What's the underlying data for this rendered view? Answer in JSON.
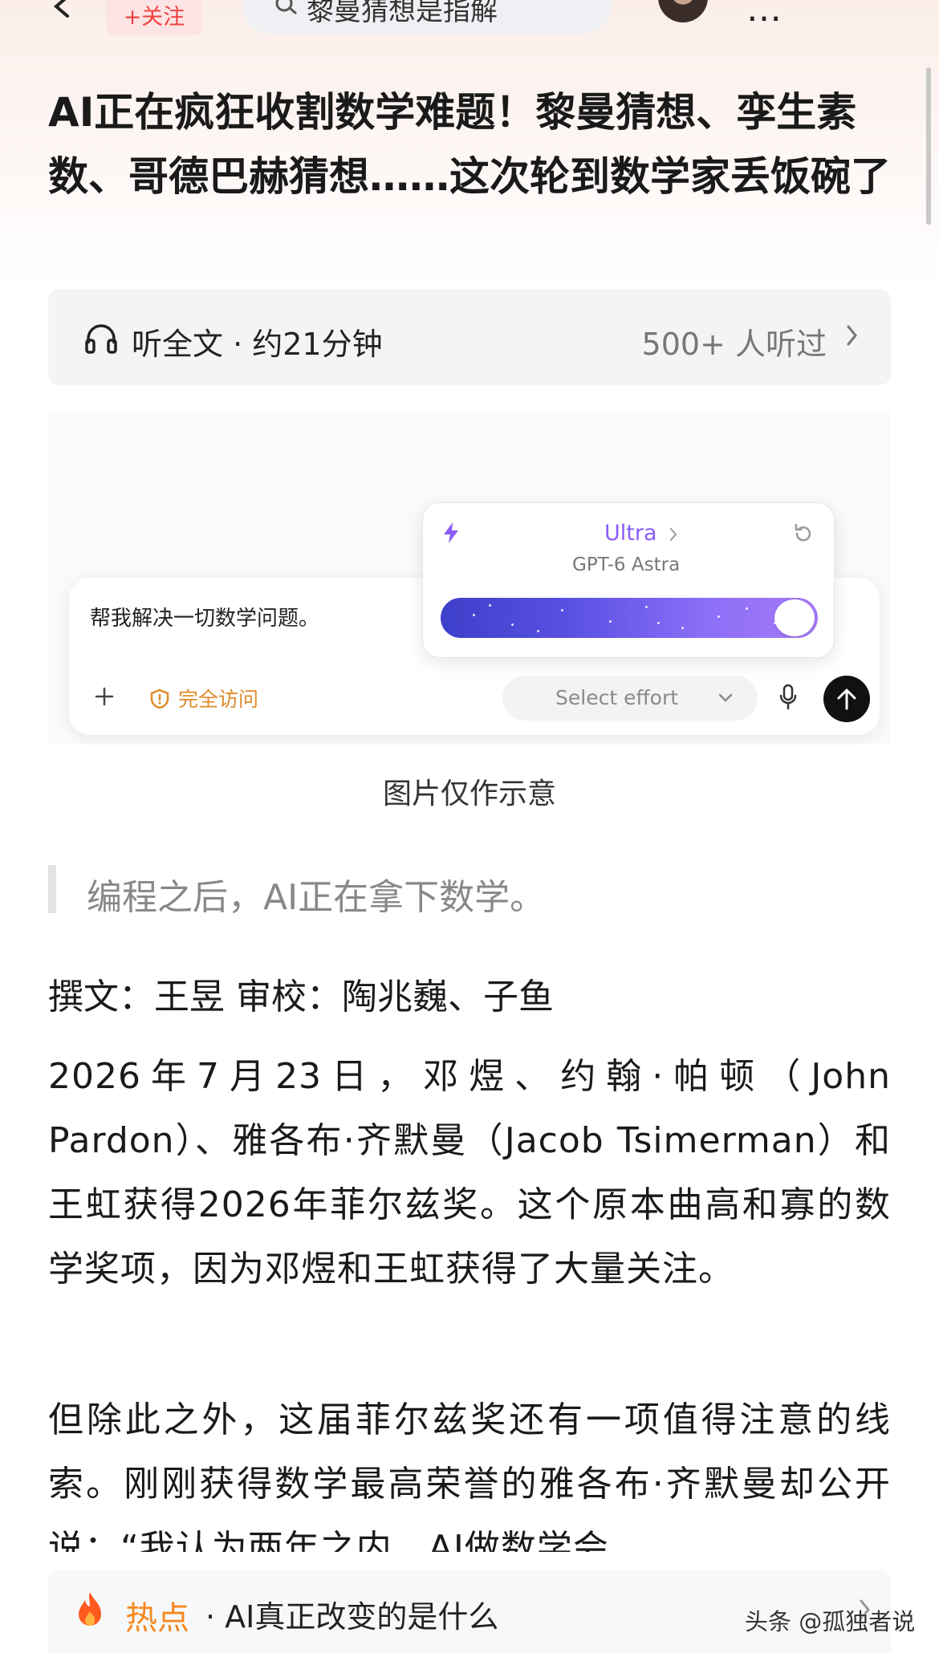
{
  "nav": {
    "follow_label": "+关注",
    "search_text": "黎曼猜想是指解",
    "more_glyph": "…"
  },
  "article": {
    "title": "AI正在疯狂收割数学难题！黎曼猜想、孪生素数、哥德巴赫猜想……这次轮到数学家丢饭碗了",
    "listen": {
      "label": "听全文 · 约21分钟",
      "listeners": "500+ 人听过"
    },
    "illustration": {
      "prompt": "帮我解决一切数学问题。",
      "access_label": "完全访问",
      "effort_placeholder": "Select effort",
      "model_tier": "Ultra",
      "model_name": "GPT-6 Astra",
      "effort_level": 1.0
    },
    "caption": "图片仅作示意",
    "quote": "编程之后，AI正在拿下数学。",
    "byline": "撰文：王昱 审校：陶兆巍、子鱼",
    "paragraphs": [
      "2026年7月23日，邓煜、约翰·帕顿（John Pardon）、雅各布·齐默曼（Jacob Tsimerman）和王虹获得2026年菲尔兹奖。这个原本曲高和寡的数学奖项，因为邓煜和王虹获得了大量关注。",
      "但除此之外，这届菲尔兹奖还有一项值得注意的线索。刚刚获得数学最高荣誉的雅各布·齐默曼却公开说：“我认为两年之内，AI做数学会"
    ]
  },
  "hot": {
    "label": "热点",
    "text": "· AI真正改变的是什么"
  },
  "watermark": "头条 @孤独者说",
  "colors": {
    "accent_red": "#f04142",
    "hot_orange": "#f5871f",
    "ultra_purple": "#8a5cf6",
    "warning_orange": "#e08a2a"
  }
}
